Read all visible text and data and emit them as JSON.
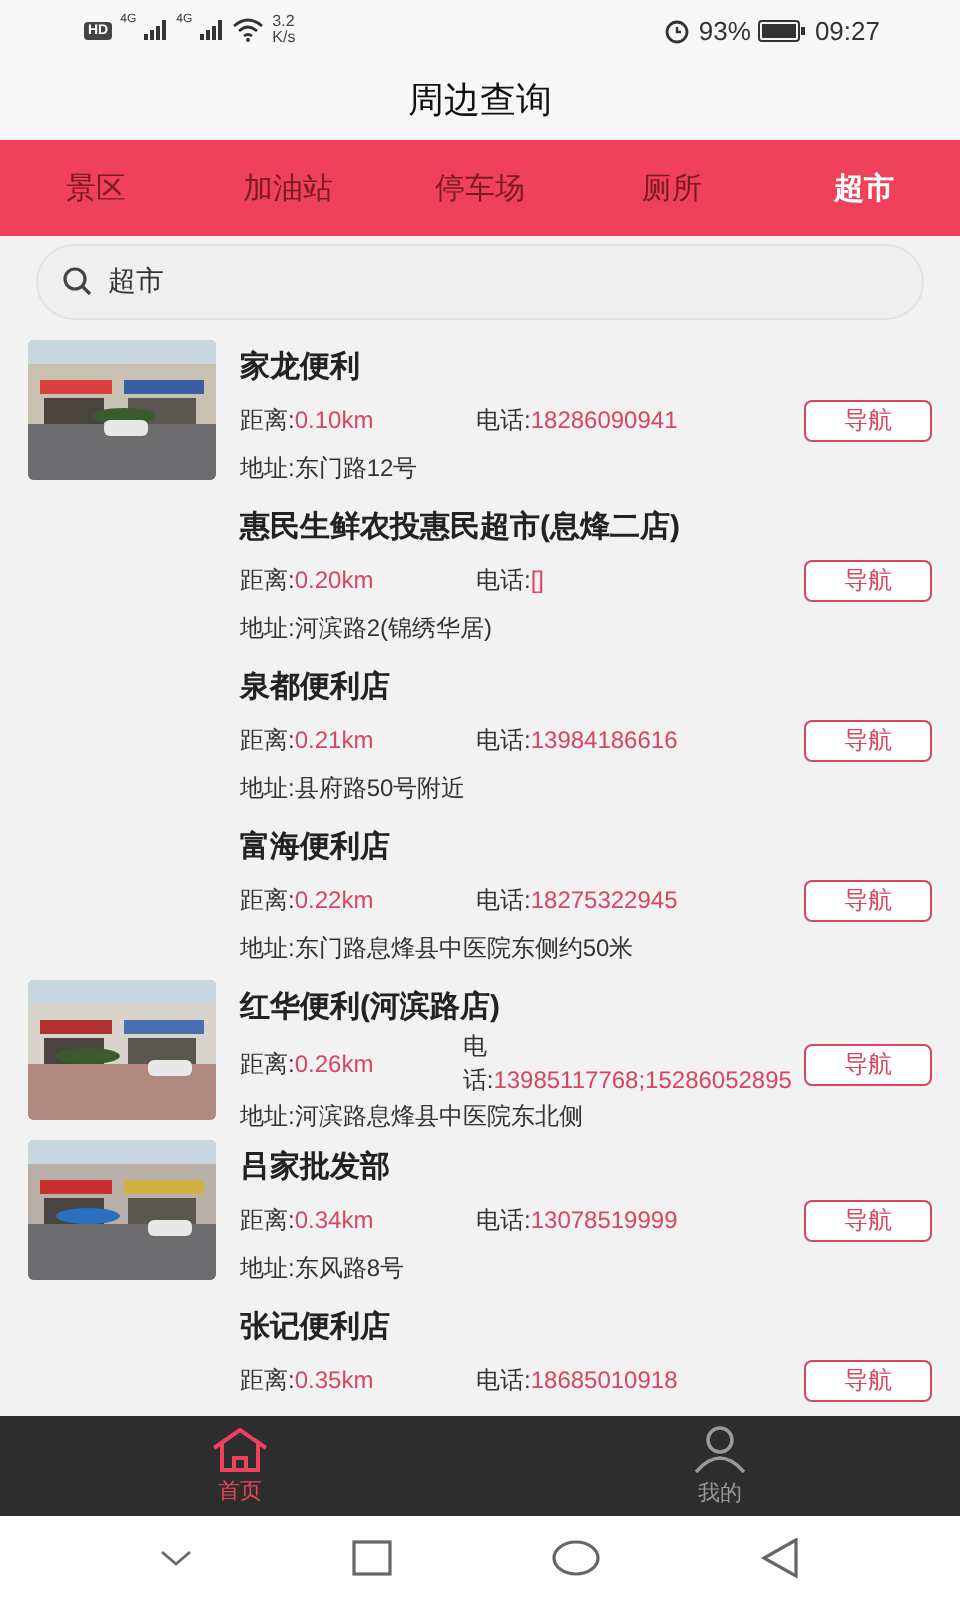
{
  "status_bar": {
    "hd": "HD",
    "signals": [
      "4G",
      "4G"
    ],
    "speed_value": "3.2",
    "speed_unit": "K/s",
    "battery": "93%",
    "time": "09:27"
  },
  "header": {
    "title": "周边查询"
  },
  "tabs": [
    {
      "label": "景区",
      "selected": false
    },
    {
      "label": "加油站",
      "selected": false
    },
    {
      "label": "停车场",
      "selected": false
    },
    {
      "label": "厕所",
      "selected": false
    },
    {
      "label": "超市",
      "selected": true
    }
  ],
  "search": {
    "value": "超市"
  },
  "stores": [
    {
      "name": "家龙便利",
      "distance_label": "距离:",
      "distance": "0.10km",
      "phone_label": "电话:",
      "phone": "18286090941",
      "address": "地址:东门路12号",
      "has_picture": true,
      "action": "导航"
    },
    {
      "name": "惠民生鲜农投惠民超市(息烽二店)",
      "distance_label": "距离:",
      "distance": "0.20km",
      "phone_label": "电话:",
      "phone": "[]",
      "address": "地址:河滨路2(锦绣华居)",
      "has_picture": false,
      "action": "导航"
    },
    {
      "name": "泉都便利店",
      "distance_label": "距离:",
      "distance": "0.21km",
      "phone_label": "电话:",
      "phone": "13984186616",
      "address": "地址:县府路50号附近",
      "has_picture": false,
      "action": "导航"
    },
    {
      "name": "富海便利店",
      "distance_label": "距离:",
      "distance": "0.22km",
      "phone_label": "电话:",
      "phone": "18275322945",
      "address": "地址:东门路息烽县中医院东侧约50米",
      "has_picture": false,
      "action": "导航"
    },
    {
      "name": "红华便利(河滨路店)",
      "distance_label": "距离:",
      "distance": "0.26km",
      "phone_label": "电话:",
      "phone": "13985117768;15286052895",
      "address": "地址:河滨路息烽县中医院东北侧",
      "has_picture": true,
      "action": "导航"
    },
    {
      "name": "吕家批发部",
      "distance_label": "距离:",
      "distance": "0.34km",
      "phone_label": "电话:",
      "phone": "13078519999",
      "address": "地址:东风路8号",
      "has_picture": true,
      "action": "导航"
    },
    {
      "name": "张记便利店",
      "distance_label": "距离:",
      "distance": "0.35km",
      "phone_label": "电话:",
      "phone": "18685010918",
      "has_picture": false,
      "action": "导航"
    }
  ],
  "bottom_nav": [
    {
      "label": "首页",
      "kind": "home",
      "selected": true
    },
    {
      "label": "我的",
      "kind": "profile",
      "selected": false
    }
  ]
}
